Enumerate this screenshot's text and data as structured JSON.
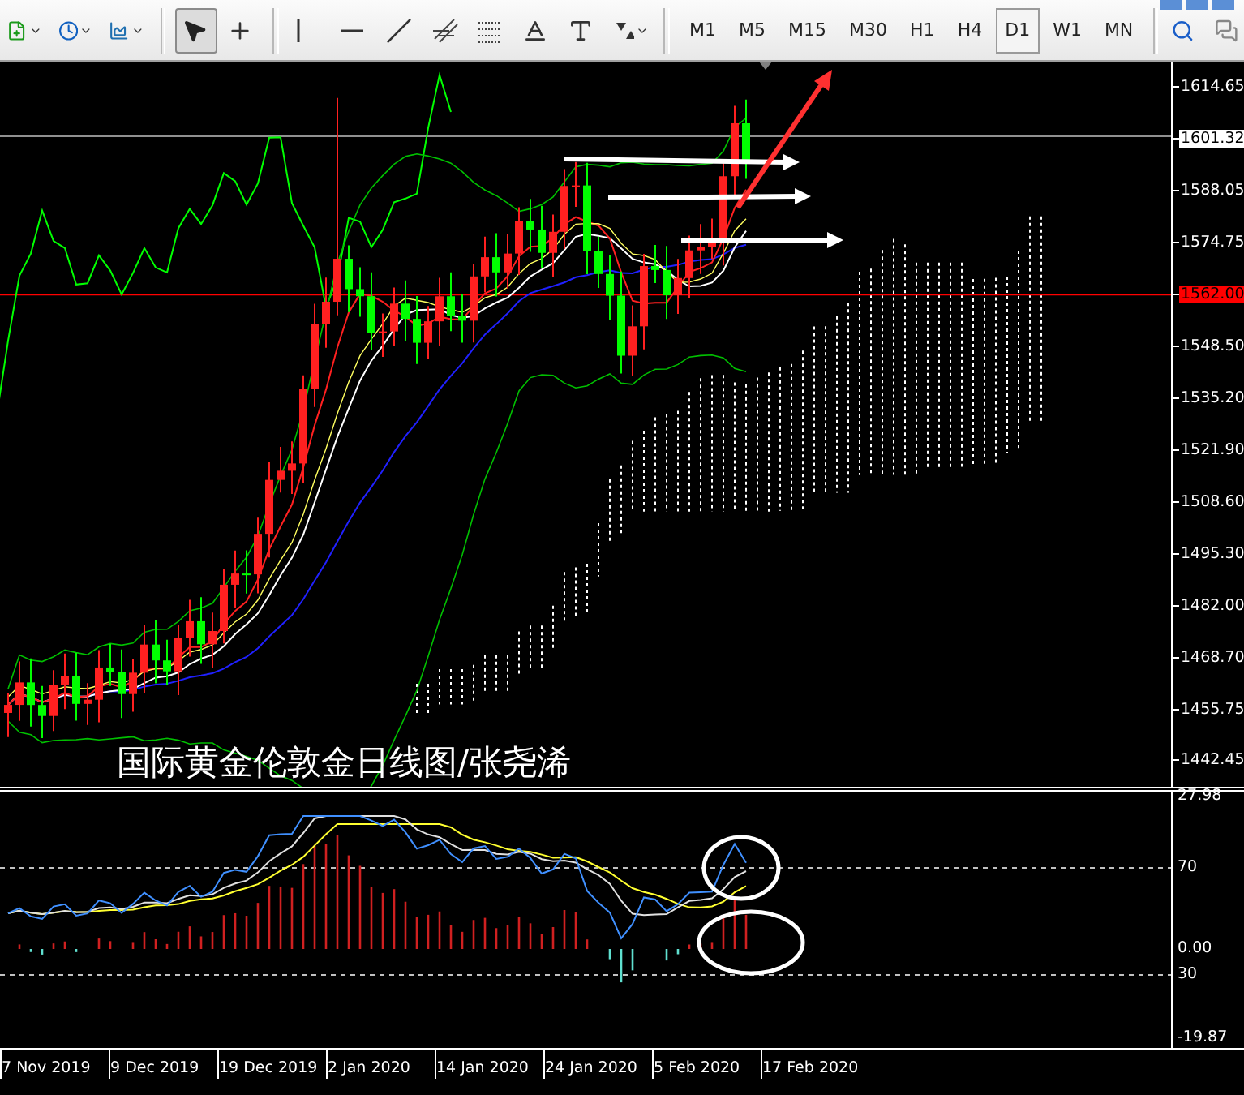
{
  "toolbar": {
    "tools": [
      {
        "kind": "new-chart",
        "selected": false
      },
      {
        "kind": "clock",
        "selected": false
      },
      {
        "kind": "template",
        "selected": false
      },
      {
        "kind": "cursor",
        "selected": true
      },
      {
        "kind": "crosshair",
        "selected": false
      },
      {
        "kind": "vertical-line",
        "selected": false
      },
      {
        "kind": "horizontal-line",
        "selected": false
      },
      {
        "kind": "trend-line",
        "selected": false
      },
      {
        "kind": "channel",
        "selected": false
      },
      {
        "kind": "fibonacci",
        "selected": false
      },
      {
        "kind": "text",
        "selected": false
      },
      {
        "kind": "label",
        "selected": false
      },
      {
        "kind": "arrows",
        "selected": false
      }
    ],
    "timeframes": [
      {
        "label": "M1",
        "selected": false
      },
      {
        "label": "M5",
        "selected": false
      },
      {
        "label": "M15",
        "selected": false
      },
      {
        "label": "M30",
        "selected": false
      },
      {
        "label": "H1",
        "selected": false
      },
      {
        "label": "H4",
        "selected": false
      },
      {
        "label": "D1",
        "selected": true
      },
      {
        "label": "W1",
        "selected": false
      },
      {
        "label": "MN",
        "selected": false
      }
    ]
  },
  "chart": {
    "title": "国际黄金伦敦金日线图/张尧浠",
    "price_scale": [
      {
        "text": "1614.65",
        "kind": "tick"
      },
      {
        "text": "1601.32",
        "kind": "price"
      },
      {
        "text": "1588.05",
        "kind": "tick"
      },
      {
        "text": "1574.75",
        "kind": "tick"
      },
      {
        "text": "1562.00",
        "kind": "line"
      },
      {
        "text": "1548.50",
        "kind": "tick"
      },
      {
        "text": "1535.20",
        "kind": "tick"
      },
      {
        "text": "1521.90",
        "kind": "tick"
      },
      {
        "text": "1508.60",
        "kind": "tick"
      },
      {
        "text": "1495.30",
        "kind": "tick"
      },
      {
        "text": "1482.00",
        "kind": "tick"
      },
      {
        "text": "1468.70",
        "kind": "tick"
      },
      {
        "text": "1455.75",
        "kind": "tick"
      },
      {
        "text": "1442.45",
        "kind": "tick"
      }
    ]
  },
  "indicator": {
    "scale": [
      "27.98",
      "70",
      "0.00",
      "30",
      "-19.87"
    ]
  },
  "x_axis": [
    "7 Nov 2019",
    "9 Dec 2019",
    "19 Dec 2019",
    "2 Jan 2020",
    "14 Jan 2020",
    "24 Jan 2020",
    "5 Feb 2020",
    "17 Feb 2020"
  ]
}
